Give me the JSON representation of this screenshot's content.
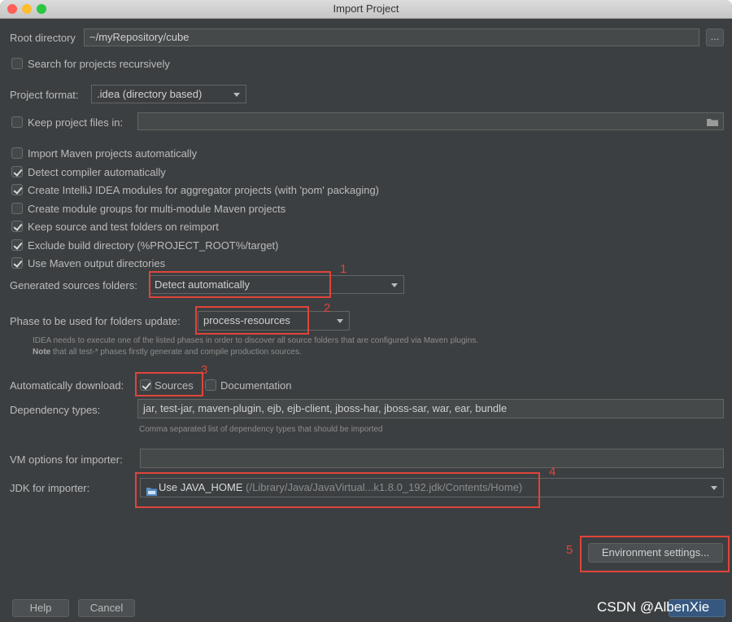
{
  "window": {
    "title": "Import Project",
    "traffic_lights": [
      "#ff5f57",
      "#febc2e",
      "#28c840"
    ]
  },
  "root_directory": {
    "label": "Root directory",
    "value": "~/myRepository/cube",
    "browse_label": "..."
  },
  "search_recursive": {
    "label": "Search for projects recursively",
    "checked": false
  },
  "project_format": {
    "label": "Project format:",
    "value": ".idea (directory based)"
  },
  "keep_files": {
    "label": "Keep project files in:",
    "checked": false,
    "value": "",
    "folder_icon": "folder-icon"
  },
  "maven_options": [
    {
      "label": "Import Maven projects automatically",
      "checked": false
    },
    {
      "label": "Detect compiler automatically",
      "checked": true
    },
    {
      "label": "Create IntelliJ IDEA modules for aggregator projects (with 'pom' packaging)",
      "checked": true
    },
    {
      "label": "Create module groups for multi-module Maven projects",
      "checked": false
    },
    {
      "label": "Keep source and test folders on reimport",
      "checked": true
    },
    {
      "label": "Exclude build directory (%PROJECT_ROOT%/target)",
      "checked": true
    },
    {
      "label": "Use Maven output directories",
      "checked": true
    }
  ],
  "generated_sources": {
    "label": "Generated sources folders:",
    "value": "Detect automatically"
  },
  "phase": {
    "label": "Phase to be used for folders update:",
    "value": "process-resources",
    "hint_line1": "IDEA needs to execute one of the listed phases in order to discover all source folders that are configured via Maven plugins.",
    "hint_note": "Note",
    "hint_line2": " that all test-* phases firstly generate and compile production sources."
  },
  "auto_download": {
    "label": "Automatically download:",
    "sources_label": "Sources",
    "sources_checked": true,
    "docs_label": "Documentation",
    "docs_checked": false
  },
  "dependency_types": {
    "label": "Dependency types:",
    "value": "jar, test-jar, maven-plugin, ejb, ejb-client, jboss-har, jboss-sar, war, ear, bundle",
    "hint": "Comma separated list of dependency types that should be imported"
  },
  "vm_options": {
    "label": "VM options for importer:",
    "value": ""
  },
  "jdk": {
    "label": "JDK for importer:",
    "value_main": "Use JAVA_HOME",
    "value_path": " (/Library/Java/JavaVirtual...k1.8.0_192.jdk/Contents/Home)",
    "icon": "folder-icon"
  },
  "environment_button": "Environment settings...",
  "buttons": {
    "help": "Help",
    "cancel": "Cancel"
  },
  "annotations": [
    "1",
    "2",
    "3",
    "4",
    "5"
  ],
  "annotation_color": "#e0443a",
  "watermark": "CSDN @AlbenXie"
}
